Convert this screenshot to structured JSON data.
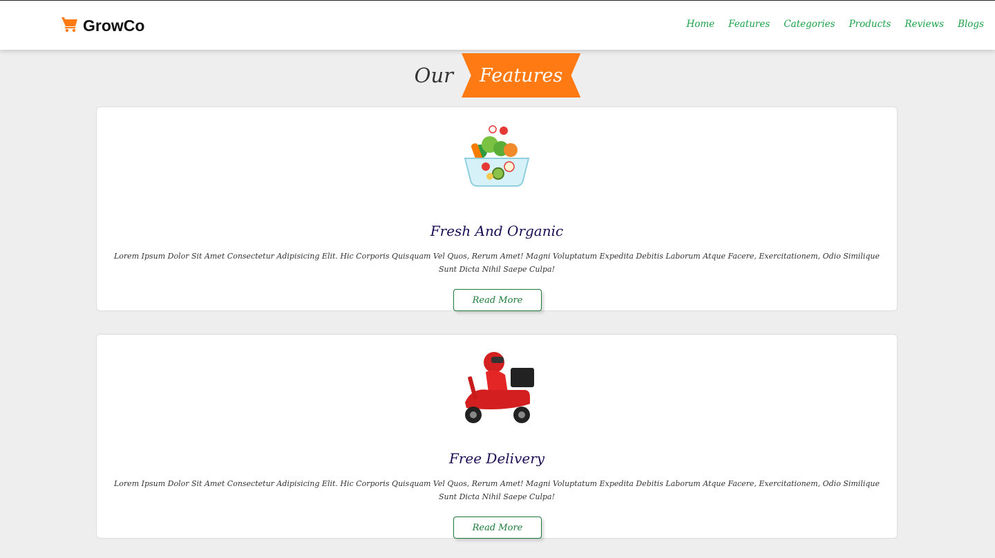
{
  "header": {
    "brand": "GrowCo",
    "nav": [
      "Home",
      "Features",
      "Categories",
      "Products",
      "Reviews",
      "Blogs"
    ]
  },
  "section": {
    "title_plain": "Our",
    "title_highlight": "Features"
  },
  "features": [
    {
      "title": "Fresh And Organic",
      "description": "Lorem Ipsum Dolor Sit Amet Consectetur Adipisicing Elit. Hic Corporis Quisquam Vel Quos, Rerum Amet! Magni Voluptatum Expedita Debitis Laborum Atque Facere, Exercitationem, Odio Similique Sunt Dicta Nihil Saepe Culpa!",
      "button": "Read More",
      "icon": "salad-bowl-icon"
    },
    {
      "title": "Free Delivery",
      "description": "Lorem Ipsum Dolor Sit Amet Consectetur Adipisicing Elit. Hic Corporis Quisquam Vel Quos, Rerum Amet! Magni Voluptatum Expedita Debitis Laborum Atque Facere, Exercitationem, Odio Similique Sunt Dicta Nihil Saepe Culpa!",
      "button": "Read More",
      "icon": "delivery-scooter-icon"
    }
  ],
  "colors": {
    "accent": "#ff7a12",
    "nav": "#1ba14a",
    "title": "#1d0d55",
    "button": "#1b7a3a"
  }
}
